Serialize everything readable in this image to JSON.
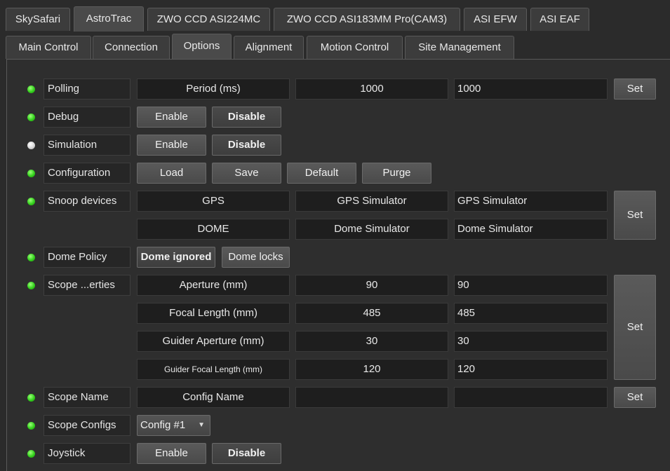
{
  "tabs": [
    "SkySafari",
    "AstroTrac",
    "ZWO CCD ASI224MC",
    "ZWO CCD ASI183MM Pro(CAM3)",
    "ASI EFW",
    "ASI EAF"
  ],
  "subtabs": [
    "Main Control",
    "Connection",
    "Options",
    "Alignment",
    "Motion Control",
    "Site Management"
  ],
  "colors": {
    "led_on": "#33d01c",
    "led_off": "#d8d8d8"
  },
  "rows": {
    "polling": {
      "label": "Polling",
      "field": "Period (ms)",
      "value": "1000",
      "input": "1000",
      "set": "Set"
    },
    "debug": {
      "label": "Debug",
      "enable": "Enable",
      "disable": "Disable"
    },
    "simulation": {
      "label": "Simulation",
      "enable": "Enable",
      "disable": "Disable"
    },
    "configuration": {
      "label": "Configuration",
      "load": "Load",
      "save": "Save",
      "default": "Default",
      "purge": "Purge"
    },
    "snoop": {
      "label": "Snoop devices",
      "gps": {
        "field": "GPS",
        "value": "GPS Simulator",
        "input": "GPS Simulator"
      },
      "dome": {
        "field": "DOME",
        "value": "Dome Simulator",
        "input": "Dome Simulator"
      },
      "set": "Set"
    },
    "dome_policy": {
      "label": "Dome Policy",
      "ignored": "Dome ignored",
      "locks": "Dome locks"
    },
    "scope_props": {
      "label": "Scope ...erties",
      "aperture": {
        "field": "Aperture (mm)",
        "value": "90",
        "input": "90"
      },
      "focal": {
        "field": "Focal Length (mm)",
        "value": "485",
        "input": "485"
      },
      "guider_aperture": {
        "field": "Guider Aperture (mm)",
        "value": "30",
        "input": "30"
      },
      "guider_focal": {
        "field": "Guider Focal Length (mm)",
        "value": "120",
        "input": "120"
      },
      "set": "Set"
    },
    "scope_name": {
      "label": "Scope Name",
      "field": "Config Name",
      "value": "",
      "input": "",
      "set": "Set"
    },
    "scope_configs": {
      "label": "Scope Configs",
      "selected": "Config #1"
    },
    "joystick": {
      "label": "Joystick",
      "enable": "Enable",
      "disable": "Disable"
    }
  }
}
